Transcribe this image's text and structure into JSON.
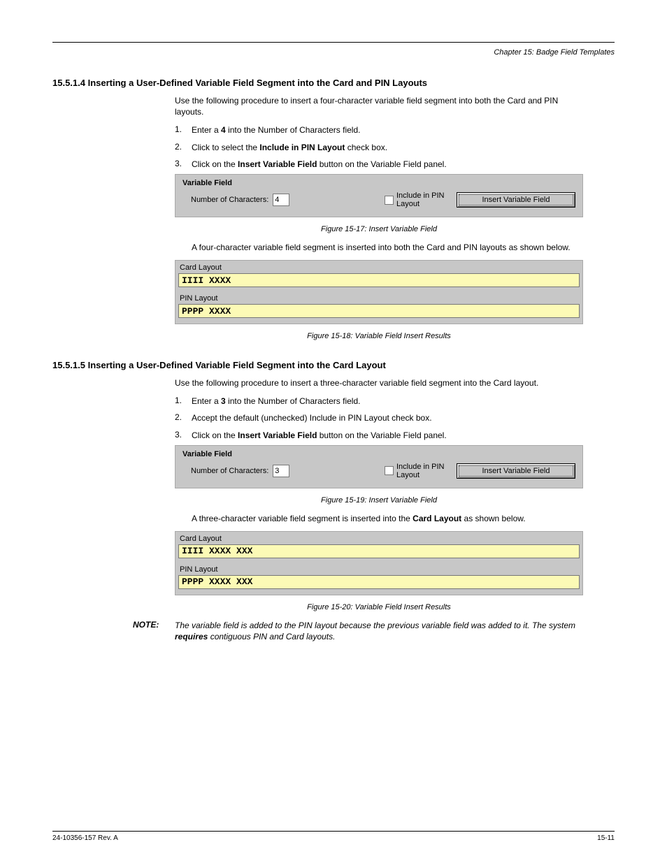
{
  "header": {
    "chapter": "Chapter 15: Badge Field Templates"
  },
  "intro": {
    "heading": "15.5.1.4  Inserting a User-Defined Variable Field Segment into the Card and PIN Layouts",
    "p1": "Use the following procedure to insert a four-character variable field segment into both the Card and PIN layouts.",
    "s1num": "1.",
    "s1a": "Enter a ",
    "s1b": "4",
    "s1c": " into the Number of Characters field.",
    "s2num": "2.",
    "s2a": "Click to select the ",
    "s2b": "Include in PIN Layout",
    "s2c": " check box.",
    "s3num": "3.",
    "s3a": "Click on the ",
    "s3b": "Insert Variable Field",
    "s3c": " button on the Variable Field panel.",
    "figA": "Figure 15-17:  Insert Variable Field",
    "resultA": "A four-character variable field segment is inserted into both the Card and PIN layouts as shown below.",
    "figB": "Figure 15-18:  Variable Field Insert Results"
  },
  "second": {
    "heading": "15.5.1.5  Inserting a User-Defined Variable Field Segment into the Card Layout",
    "p1": "Use the following procedure to insert a three-character variable field segment into the Card layout.",
    "s1num": "1.",
    "s1a": "Enter a ",
    "s1b": "3",
    "s1c": " into the Number of Characters field.",
    "s2num": "2.",
    "s2a": "Accept the default (unchecked) Include in PIN Layout check box.",
    "s3num": "3.",
    "s3a": "Click on the ",
    "s3b": "Insert Variable Field",
    "s3c": " button on the Variable Field panel.",
    "figA": "Figure 15-19:  Insert Variable Field",
    "resultA_a": "A three-character variable field segment is inserted into the ",
    "resultA_b": "Card Layout",
    "resultA_c": " as shown below.",
    "figB": "Figure 15-20:  Variable Field Insert Results",
    "noteLabel": "NOTE:",
    "noteText_a": "The variable field is added to the PIN layout because the previous variable field was added to it. The system ",
    "noteText_b": "requires",
    "noteText_c": " contiguous PIN and Card layouts."
  },
  "panel1": {
    "title": "Variable Field",
    "numLabel": "Number of Characters:",
    "numValue": "4",
    "checkLabel": "Include in PIN Layout",
    "button": "Insert  Variable Field"
  },
  "layouts1": {
    "cardLabel": "Card Layout",
    "cardValue": "IIII XXXX",
    "pinLabel": "PIN Layout",
    "pinValue": "PPPP XXXX"
  },
  "panel2": {
    "title": "Variable Field",
    "numLabel": "Number of Characters:",
    "numValue": "3",
    "checkLabel": "Include in PIN Layout",
    "button": "Insert  Variable Field"
  },
  "layouts2": {
    "cardLabel": "Card Layout",
    "cardValue": "IIII XXXX XXX",
    "pinLabel": "PIN Layout",
    "pinValue": "PPPP XXXX XXX"
  },
  "footer": {
    "date": "24-10356-157 Rev. A",
    "page": "15-11"
  }
}
